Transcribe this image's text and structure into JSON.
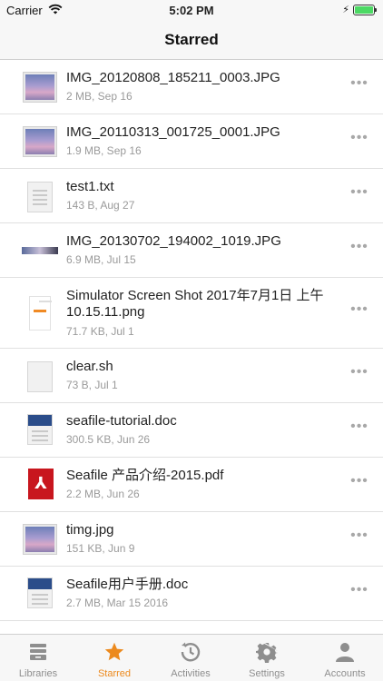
{
  "status_bar": {
    "carrier": "Carrier",
    "time": "5:02 PM"
  },
  "nav": {
    "title": "Starred"
  },
  "files": [
    {
      "name": "IMG_20120808_185211_0003.JPG",
      "meta": "2 MB, Sep 16",
      "thumb": "image"
    },
    {
      "name": "IMG_20110313_001725_0001.JPG",
      "meta": "1.9 MB, Sep 16",
      "thumb": "image"
    },
    {
      "name": "test1.txt",
      "meta": "143 B, Aug 27",
      "thumb": "text-doc"
    },
    {
      "name": "IMG_20130702_194002_1019.JPG",
      "meta": "6.9 MB, Jul 15",
      "thumb": "panorama"
    },
    {
      "name": "Simulator Screen Shot 2017年7月1日 上午10.15.11.png",
      "meta": "71.7 KB, Jul 1",
      "thumb": "screenshot"
    },
    {
      "name": "clear.sh",
      "meta": "73 B, Jul 1",
      "thumb": "blank-doc"
    },
    {
      "name": "seafile-tutorial.doc",
      "meta": "300.5 KB, Jun 26",
      "thumb": "word-doc"
    },
    {
      "name": "Seafile 产品介绍-2015.pdf",
      "meta": "2.2 MB, Jun 26",
      "thumb": "pdf"
    },
    {
      "name": "timg.jpg",
      "meta": "151 KB, Jun 9",
      "thumb": "image"
    },
    {
      "name": "Seafile用户手册.doc",
      "meta": "2.7 MB, Mar 15 2016",
      "thumb": "word-doc"
    }
  ],
  "more_label": "•••",
  "tabs": [
    {
      "label": "Libraries",
      "icon": "libraries-icon"
    },
    {
      "label": "Starred",
      "icon": "star-icon",
      "active": true
    },
    {
      "label": "Activities",
      "icon": "activities-icon"
    },
    {
      "label": "Settings",
      "icon": "gear-icon"
    },
    {
      "label": "Accounts",
      "icon": "person-icon"
    }
  ],
  "colors": {
    "accent": "#ec8a1e",
    "battery": "#4cd964",
    "inactive_tab": "#8e8e8e"
  }
}
